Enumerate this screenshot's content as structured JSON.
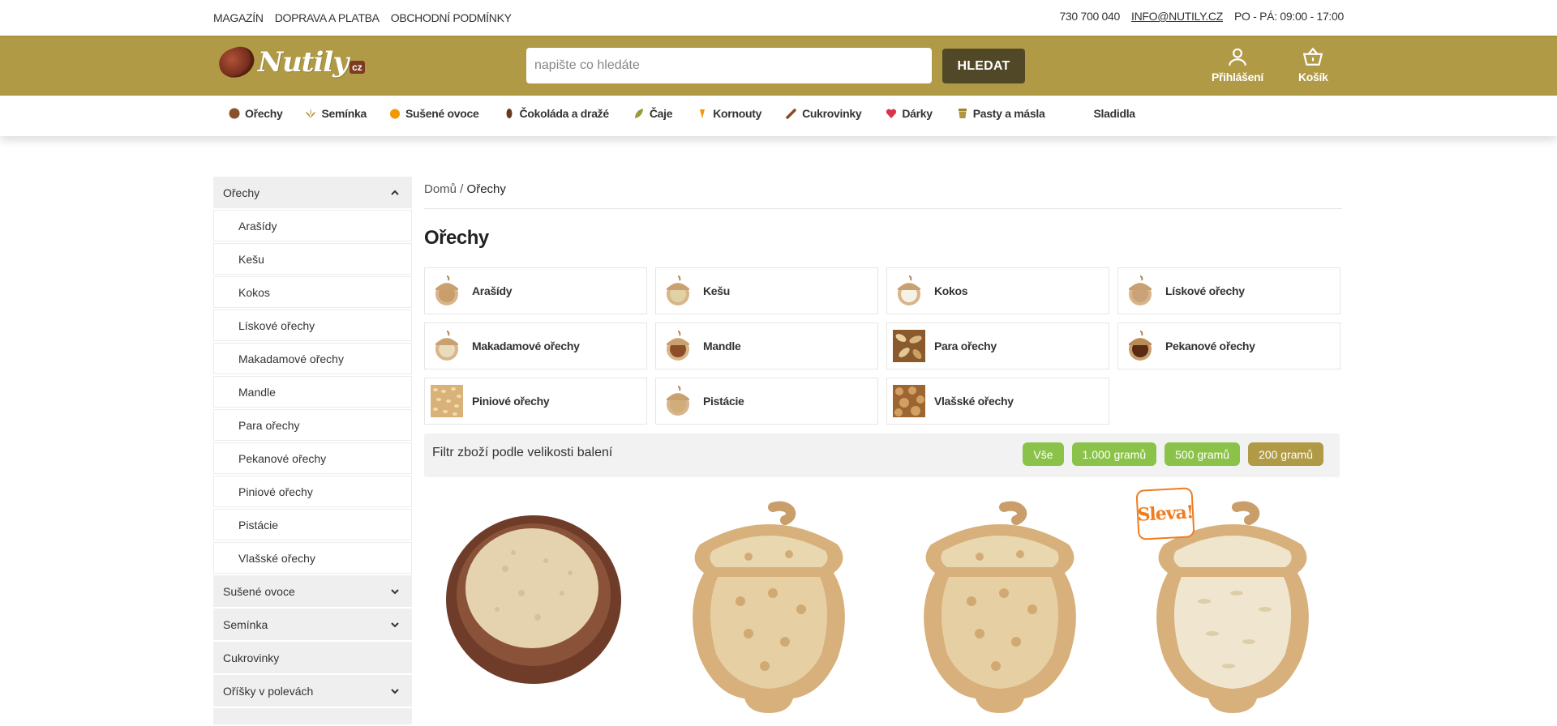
{
  "topbar": {
    "links": [
      "MAGAZÍN",
      "DOPRAVA A PLATBA",
      "OBCHODNÍ PODMÍNKY"
    ],
    "phone": "730 700 040",
    "email": "INFO@NUTILY.CZ",
    "hours": "PO - PÁ: 09:00 - 17:00"
  },
  "header": {
    "logo_text": "Nutily",
    "logo_cz": "cz",
    "search_placeholder": "napište co hledáte",
    "search_button": "HLEDAT",
    "login_label": "Přihlášení",
    "cart_label": "Košík",
    "brand_color": "#b09a45"
  },
  "catnav": {
    "items": [
      {
        "label": "Ořechy",
        "icon": "nut-icon"
      },
      {
        "label": "Semínka",
        "icon": "seeds-icon"
      },
      {
        "label": "Sušené ovoce",
        "icon": "fruit-icon"
      },
      {
        "label": "Čokoláda a dražé",
        "icon": "chocolate-icon"
      },
      {
        "label": "Čaje",
        "icon": "tea-leaf-icon"
      },
      {
        "label": "Kornouty",
        "icon": "cone-icon"
      },
      {
        "label": "Cukrovinky",
        "icon": "candy-icon"
      },
      {
        "label": "Dárky",
        "icon": "heart-icon"
      },
      {
        "label": "Pasty a másla",
        "icon": "jar-icon"
      },
      {
        "label": "Sladidla",
        "icon": ""
      }
    ]
  },
  "sidebar": {
    "active": "Ořechy",
    "sub_items": [
      "Arašídy",
      "Kešu",
      "Kokos",
      "Lískové ořechy",
      "Makadamové ořechy",
      "Mandle",
      "Para ořechy",
      "Pekanové ořechy",
      "Piniové ořechy",
      "Pistácie",
      "Vlašské ořechy"
    ],
    "other": [
      {
        "label": "Sušené ovoce",
        "has_children": true
      },
      {
        "label": "Semínka",
        "has_children": true
      },
      {
        "label": "Cukrovinky",
        "has_children": false
      },
      {
        "label": "Oříšky v polevách",
        "has_children": true
      }
    ]
  },
  "breadcrumb": {
    "home": "Domů",
    "separator": " / ",
    "current": "Ořechy"
  },
  "page_title": "Ořechy",
  "subcategories": [
    {
      "label": "Arašídy",
      "thumb": "acorn-light"
    },
    {
      "label": "Kešu",
      "thumb": "acorn-light"
    },
    {
      "label": "Kokos",
      "thumb": "acorn-white"
    },
    {
      "label": "Lískové ořechy",
      "thumb": "acorn-light"
    },
    {
      "label": "Makadamové ořechy",
      "thumb": "acorn-light"
    },
    {
      "label": "Mandle",
      "thumb": "acorn-brown"
    },
    {
      "label": "Para ořechy",
      "thumb": "square-nuts"
    },
    {
      "label": "Pekanové ořechy",
      "thumb": "acorn-dark"
    },
    {
      "label": "Piniové ořechy",
      "thumb": "square-pine"
    },
    {
      "label": "Pistácie",
      "thumb": "acorn-light"
    },
    {
      "label": "Vlašské ořechy",
      "thumb": "square-walnut"
    }
  ],
  "filter": {
    "label": "Filtr zboží podle velikosti balení",
    "options": [
      "Vše",
      "1.000 gramů",
      "500 gramů",
      "200 gramů"
    ],
    "active": "200 gramů"
  },
  "products": [
    {
      "image": "bowl-ground-nuts"
    },
    {
      "image": "acorn-bowl-peanuts"
    },
    {
      "image": "acorn-bowl-peanuts"
    },
    {
      "image": "acorn-bowl-pine",
      "badge": "Sleva!"
    }
  ]
}
